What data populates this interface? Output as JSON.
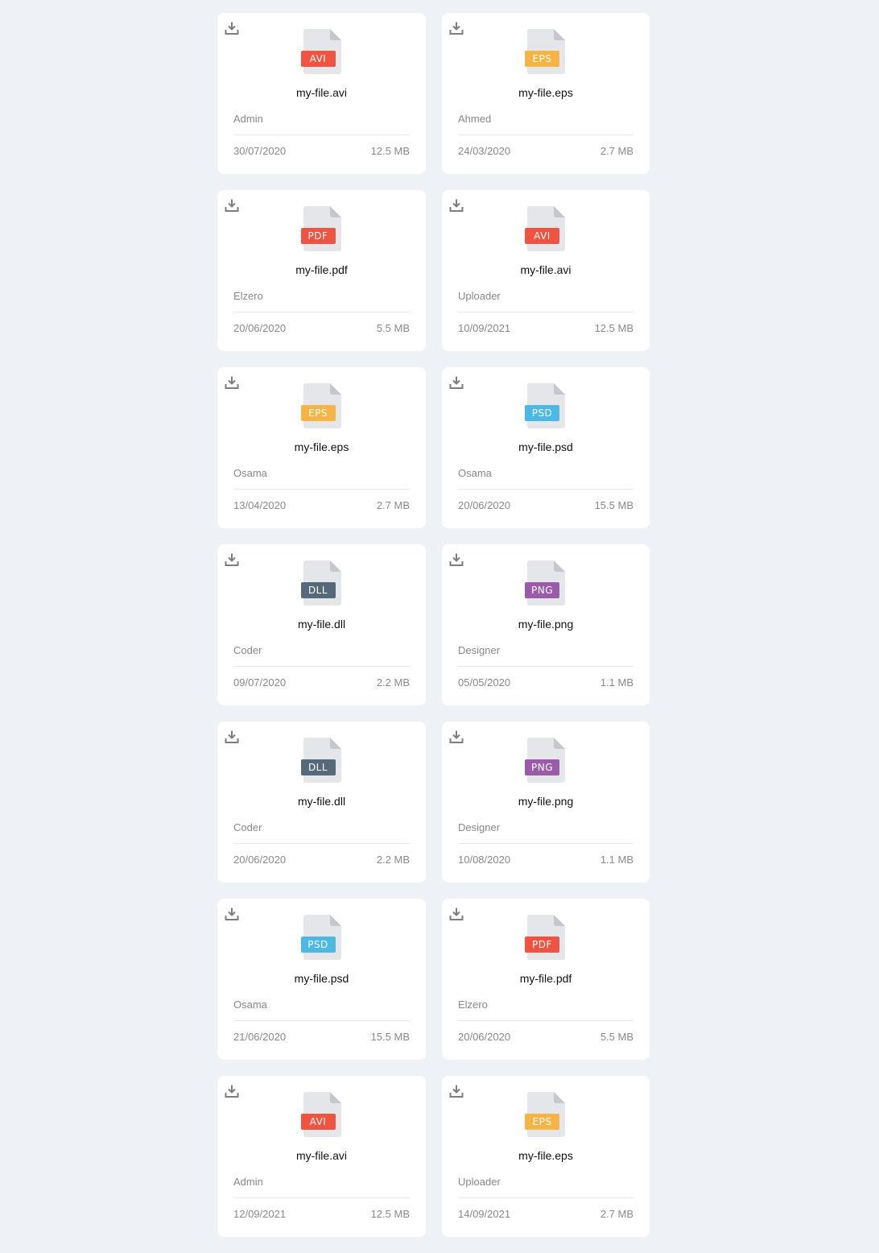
{
  "type_colors": {
    "AVI": "#f0533f",
    "EPS": "#f6b444",
    "PDF": "#f0533f",
    "PSD": "#4cb8e6",
    "DLL": "#56697b",
    "PNG": "#9a5ba9"
  },
  "icons": {
    "download": "download-icon",
    "file": "file-icon"
  },
  "files": [
    {
      "type": "AVI",
      "name": "my-file.avi",
      "owner": "Admin",
      "date": "30/07/2020",
      "size": "12.5 MB"
    },
    {
      "type": "EPS",
      "name": "my-file.eps",
      "owner": "Ahmed",
      "date": "24/03/2020",
      "size": "2.7 MB"
    },
    {
      "type": "PDF",
      "name": "my-file.pdf",
      "owner": "Elzero",
      "date": "20/06/2020",
      "size": "5.5 MB"
    },
    {
      "type": "AVI",
      "name": "my-file.avi",
      "owner": "Uploader",
      "date": "10/09/2021",
      "size": "12.5 MB"
    },
    {
      "type": "EPS",
      "name": "my-file.eps",
      "owner": "Osama",
      "date": "13/04/2020",
      "size": "2.7 MB"
    },
    {
      "type": "PSD",
      "name": "my-file.psd",
      "owner": "Osama",
      "date": "20/06/2020",
      "size": "15.5 MB"
    },
    {
      "type": "DLL",
      "name": "my-file.dll",
      "owner": "Coder",
      "date": "09/07/2020",
      "size": "2.2 MB"
    },
    {
      "type": "PNG",
      "name": "my-file.png",
      "owner": "Designer",
      "date": "05/05/2020",
      "size": "1.1 MB"
    },
    {
      "type": "DLL",
      "name": "my-file.dll",
      "owner": "Coder",
      "date": "20/06/2020",
      "size": "2.2 MB"
    },
    {
      "type": "PNG",
      "name": "my-file.png",
      "owner": "Designer",
      "date": "10/08/2020",
      "size": "1.1 MB"
    },
    {
      "type": "PSD",
      "name": "my-file.psd",
      "owner": "Osama",
      "date": "21/06/2020",
      "size": "15.5 MB"
    },
    {
      "type": "PDF",
      "name": "my-file.pdf",
      "owner": "Elzero",
      "date": "20/06/2020",
      "size": "5.5 MB"
    },
    {
      "type": "AVI",
      "name": "my-file.avi",
      "owner": "Admin",
      "date": "12/09/2021",
      "size": "12.5 MB"
    },
    {
      "type": "EPS",
      "name": "my-file.eps",
      "owner": "Uploader",
      "date": "14/09/2021",
      "size": "2.7 MB"
    }
  ]
}
